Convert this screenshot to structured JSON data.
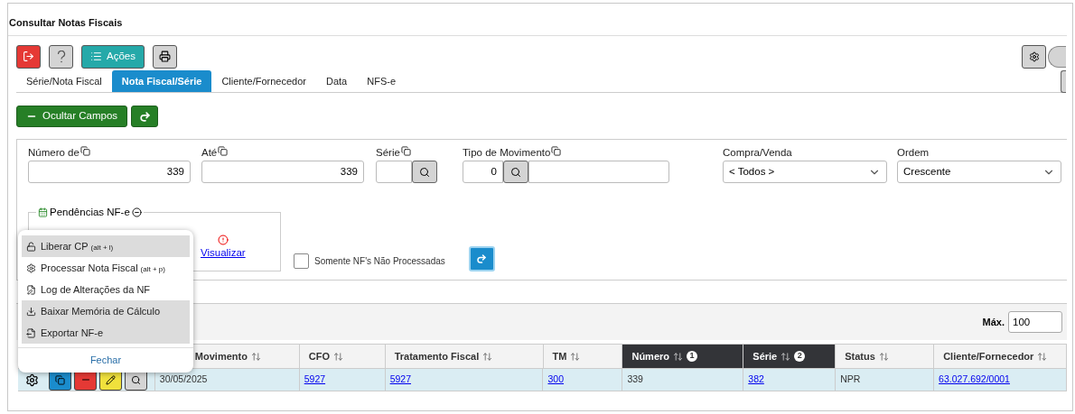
{
  "title": "Consultar Notas Fiscais",
  "toolbar": {
    "actions_label": "Ações"
  },
  "tabs": [
    {
      "label": "Série/Nota Fiscal",
      "selected": false
    },
    {
      "label": "Nota Fiscal/Série",
      "selected": true
    },
    {
      "label": "Cliente/Fornecedor",
      "selected": false
    },
    {
      "label": "Data",
      "selected": false
    },
    {
      "label": "NFS-e",
      "selected": false
    }
  ],
  "hide_fields_button": "Ocultar Campos",
  "filters": [
    {
      "kind": "text",
      "label": "Número de",
      "value": "339"
    },
    {
      "kind": "text",
      "label": "Até",
      "value": "339"
    },
    {
      "kind": "lookup",
      "label": "Série"
    },
    {
      "kind": "lookup_wide",
      "label": "Tipo de Movimento",
      "value": "0"
    },
    {
      "kind": "select",
      "label": "Compra/Venda",
      "value": "< Todos >"
    },
    {
      "kind": "select",
      "label": "Ordem",
      "value": "Crescente"
    }
  ],
  "pending": {
    "title": "Pendências NF-e",
    "link": "Visualizar"
  },
  "only_unprocessed": {
    "label": "Somente NF's Não Processadas",
    "checked": false
  },
  "max": {
    "label": "Máx.",
    "value": "100"
  },
  "columns": [
    {
      "label": "Movimento",
      "sorted": false
    },
    {
      "label": "CFO",
      "sorted": false
    },
    {
      "label": "Tratamento Fiscal",
      "sorted": false
    },
    {
      "label": "TM",
      "sorted": false
    },
    {
      "label": "Número",
      "sorted": true,
      "order": "1"
    },
    {
      "label": "Série",
      "sorted": true,
      "order": "2"
    },
    {
      "label": "Status",
      "sorted": false
    },
    {
      "label": "Cliente/Fornecedor",
      "sorted": false
    }
  ],
  "rows": [
    {
      "selected": true,
      "cells": [
        {
          "text": "30/05/2025",
          "link": false
        },
        {
          "text": "5927",
          "link": true
        },
        {
          "text": "5927",
          "link": true
        },
        {
          "text": "300",
          "link": true
        },
        {
          "text": "339",
          "link": false
        },
        {
          "text": "382",
          "link": true
        },
        {
          "text": "NPR",
          "link": false
        },
        {
          "text": "63.027.692/0001",
          "link": true
        }
      ]
    }
  ],
  "menu": {
    "items": [
      {
        "kind": "unlock",
        "label": "Liberar CP",
        "shortcut": "(alt + l)",
        "highlighted": true
      },
      {
        "kind": "gear",
        "label": "Processar Nota Fiscal",
        "shortcut": "(alt + p)",
        "highlighted": false
      },
      {
        "kind": "doc-edit",
        "label": "Log de Alterações da NF",
        "highlighted": false
      },
      {
        "kind": "download",
        "label": "Baixar Memória de Cálculo",
        "highlighted": true
      },
      {
        "kind": "export",
        "label": "Exportar NF-e",
        "highlighted": true
      }
    ],
    "close": "Fechar"
  }
}
